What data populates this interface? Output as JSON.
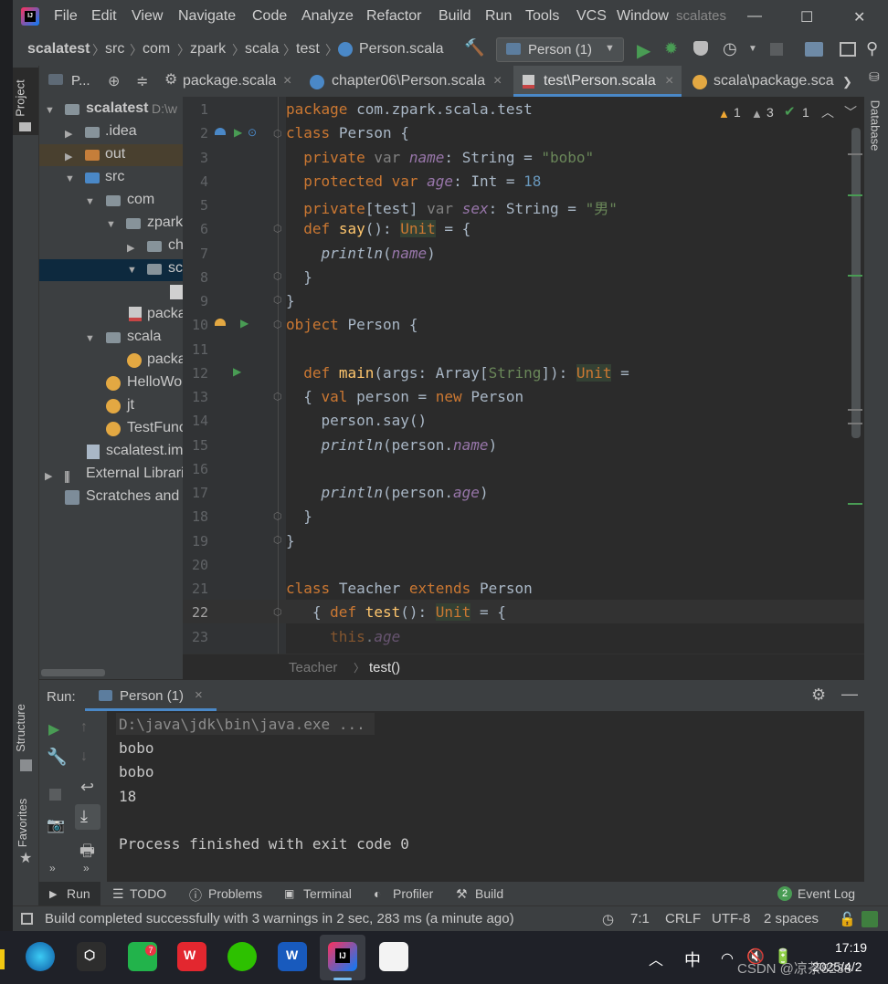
{
  "titlebar": {
    "menus": [
      "File",
      "Edit",
      "View",
      "Navigate",
      "Code",
      "Analyze",
      "Refactor",
      "Build",
      "Run",
      "Tools",
      "VCS",
      "Window"
    ],
    "project_name": "scalates",
    "min": "—",
    "max": "☐",
    "close": "✕"
  },
  "navbar": {
    "crumbs": [
      "scalatest",
      "src",
      "com",
      "zpark",
      "scala",
      "test",
      "Person.scala"
    ],
    "run_config": "Person (1)"
  },
  "project_panel": {
    "title": "P...",
    "root": "scalatest",
    "root_path": "D:\\w",
    "items": [
      ".idea",
      "out",
      "src",
      "com",
      "zpark",
      "ch",
      "sc",
      "packa",
      "scala",
      "packa",
      "HelloWo",
      "jt",
      "TestFunc",
      "scalatest.im",
      "External Librari",
      "Scratches and"
    ]
  },
  "tabs": [
    {
      "label": "package.scala"
    },
    {
      "label": "chapter06\\Person.scala"
    },
    {
      "label": "test\\Person.scala"
    },
    {
      "label": "scala\\package.sca"
    }
  ],
  "inspections": {
    "warn1": "1",
    "warn2": "3",
    "ok": "1"
  },
  "editor": {
    "line_numbers": [
      "1",
      "2",
      "3",
      "4",
      "5",
      "6",
      "7",
      "8",
      "9",
      "10",
      "11",
      "12",
      "13",
      "14",
      "15",
      "16",
      "17",
      "18",
      "19",
      "20",
      "21",
      "22",
      "23"
    ],
    "l1": [
      "package",
      "com.zpark.scala.test"
    ],
    "l2": [
      "class",
      "Person {"
    ],
    "l3": [
      "private",
      "var",
      "name",
      ": String = ",
      "\"bobo\""
    ],
    "l4": [
      "protected",
      "var",
      "age",
      ": Int = ",
      "18"
    ],
    "l5": [
      "private",
      "[test] ",
      "var",
      "sex",
      ": String = ",
      "\"男\""
    ],
    "l6": [
      "def",
      "say",
      "(): ",
      "Unit",
      " = {"
    ],
    "l7": [
      "println",
      "(",
      "name",
      ")"
    ],
    "l8": "}",
    "l9": "}",
    "l10": [
      "object",
      "Person {"
    ],
    "l12": [
      "def",
      "main",
      "(args: Array[",
      "String",
      "]): ",
      "Unit",
      " ="
    ],
    "l13": [
      "{ ",
      "val",
      "person = ",
      "new",
      "Person"
    ],
    "l14": "person.say()",
    "l15": [
      "println",
      "(person.",
      "name",
      ")"
    ],
    "l17": [
      "println",
      "(person.",
      "age",
      ")"
    ],
    "l18": "}",
    "l19": "}",
    "l21": [
      "class",
      "Teacher ",
      "extends",
      "Person"
    ],
    "l22": [
      "{ ",
      "def",
      "test",
      "(): ",
      "Unit",
      " = {"
    ],
    "l23": [
      "this",
      ".",
      "age"
    ]
  },
  "code_breadcrumb": [
    "Teacher",
    "test()"
  ],
  "run_panel": {
    "label": "Run:",
    "tab": "Person (1)",
    "output": [
      "D:\\java\\jdk\\bin\\java.exe ...",
      "bobo",
      "bobo",
      "18",
      "",
      "Process finished with exit code 0"
    ]
  },
  "left_stripe": {
    "project": "Project",
    "structure": "Structure",
    "favorites": "Favorites"
  },
  "right_stripe": {
    "database": "Database"
  },
  "bottom_tabs": [
    "Run",
    "TODO",
    "Problems",
    "Terminal",
    "Profiler",
    "Build"
  ],
  "event_log": {
    "count": "2",
    "label": "Event Log"
  },
  "status": {
    "message": "Build completed successfully with 3 warnings in 2 sec, 283 ms (a minute ago)",
    "position": "7:1",
    "line_sep": "CRLF",
    "encoding": "UTF-8",
    "indent": "2 spaces"
  },
  "taskbar": {
    "time": "17:19",
    "date": "2025/4/2",
    "ime": "中",
    "watermark": "CSDN @凉茶8238",
    "badge": "7"
  },
  "colors": {
    "accent": "#4a88c7",
    "run_green": "#499c54",
    "keyword": "#cc7832",
    "string": "#6a8759",
    "number": "#6897bb"
  }
}
